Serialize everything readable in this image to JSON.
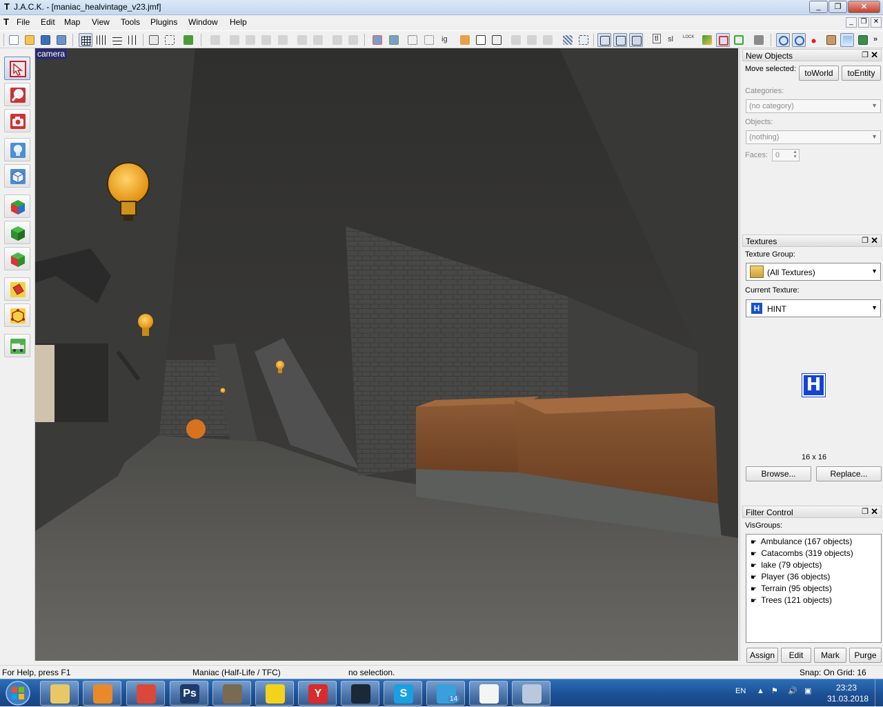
{
  "window": {
    "title": "J.A.C.K. - [maniac_healvintage_v23.jmf]",
    "controls": [
      "_",
      "❐",
      "✕"
    ]
  },
  "menu": {
    "items": [
      "File",
      "Edit",
      "Map",
      "View",
      "Tools",
      "Plugins",
      "Window",
      "Help"
    ]
  },
  "toolbar": {
    "text_buttons": [
      "ig",
      "sl",
      "tl"
    ]
  },
  "left_tools": [
    {
      "name": "selection-tool",
      "icon": "arrow-cursor-icon"
    },
    {
      "name": "magnify-tool",
      "icon": "magnifier-icon"
    },
    {
      "name": "camera-tool",
      "icon": "camera-icon"
    },
    {
      "name": "entity-tool",
      "icon": "light-bulb-icon"
    },
    {
      "name": "block-tool",
      "icon": "cube-icon"
    },
    {
      "name": "texture-application-tool",
      "icon": "rgb-cube-icon"
    },
    {
      "name": "apply-current-texture-tool",
      "icon": "green-cube-icon"
    },
    {
      "name": "decal-tool",
      "icon": "red-green-cube-icon"
    },
    {
      "name": "clipping-tool",
      "icon": "book-icon"
    },
    {
      "name": "vertex-manipulation-tool",
      "icon": "vertex-cube-icon"
    },
    {
      "name": "path-tool",
      "icon": "truck-icon"
    }
  ],
  "viewport": {
    "label": "camera"
  },
  "new_objects": {
    "title": "New Objects",
    "move_selected_label": "Move selected:",
    "to_world": "toWorld",
    "to_entity": "toEntity",
    "categories_label": "Categories:",
    "categories_value": "(no category)",
    "objects_label": "Objects:",
    "objects_value": "(nothing)",
    "faces_label": "Faces:",
    "faces_value": "0"
  },
  "textures": {
    "title": "Textures",
    "group_label": "Texture Group:",
    "group_value": "(All Textures)",
    "current_label": "Current Texture:",
    "current_value": "HINT",
    "preview_glyph": "H",
    "size": "16 x 16",
    "browse": "Browse...",
    "replace": "Replace..."
  },
  "filter_control": {
    "title": "Filter Control",
    "visgroups_label": "VisGroups:",
    "visgroups": [
      "Ambulance (167 objects)",
      "Catacombs (319 objects)",
      "lake (79 objects)",
      "Player (36 objects)",
      "Terrain (95 objects)",
      "Trees (121 objects)"
    ],
    "buttons": [
      "Assign",
      "Edit",
      "Mark",
      "Purge"
    ]
  },
  "status": {
    "help": "For Help, press F1",
    "game": "Maniac (Half-Life / TFC)",
    "selection": "no selection.",
    "snap": "Snap: On Grid: 16"
  },
  "taskbar": {
    "apps": [
      {
        "name": "explorer",
        "icon": "folder-icon",
        "color": "#e8c766"
      },
      {
        "name": "media-player",
        "icon": "play-icon",
        "color": "#e88a2c"
      },
      {
        "name": "chrome",
        "icon": "chrome-icon",
        "color": "#d9493a"
      },
      {
        "name": "photoshop",
        "icon": "photoshop-icon",
        "color": "#1f3b6a",
        "text": "Ps"
      },
      {
        "name": "gimp",
        "icon": "gimp-icon",
        "color": "#7a6a52"
      },
      {
        "name": "messenger",
        "icon": "smiley-icon",
        "color": "#f3d21b"
      },
      {
        "name": "yandex",
        "icon": "yandex-icon",
        "color": "#d92b2b",
        "text": "Y"
      },
      {
        "name": "steam",
        "icon": "steam-icon",
        "color": "#1b2838"
      },
      {
        "name": "skype",
        "icon": "skype-icon",
        "color": "#1a9fe0",
        "text": "S"
      },
      {
        "name": "telegram",
        "icon": "telegram-icon",
        "color": "#37a0dd",
        "badge": "14"
      },
      {
        "name": "jack",
        "icon": "jack-icon",
        "color": "#f4f4f4"
      },
      {
        "name": "paint",
        "icon": "paint-icon",
        "color": "#b9c8dc"
      }
    ],
    "lang": "EN",
    "time": "23:23",
    "date": "31.03.2018"
  }
}
